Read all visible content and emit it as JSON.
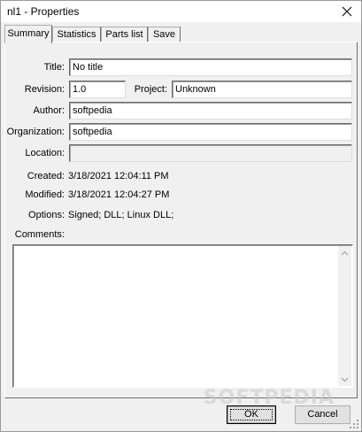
{
  "window": {
    "title": "nl1 - Properties"
  },
  "tabs": [
    {
      "label": "Summary",
      "active": true
    },
    {
      "label": "Statistics",
      "active": false
    },
    {
      "label": "Parts list",
      "active": false
    },
    {
      "label": "Save",
      "active": false
    }
  ],
  "form": {
    "title_label": "Title:",
    "title_value": "No title",
    "revision_label": "Revision:",
    "revision_value": "1.0",
    "project_label": "Project:",
    "project_value": "Unknown",
    "author_label": "Author:",
    "author_value": "softpedia",
    "organization_label": "Organization:",
    "organization_value": "softpedia",
    "location_label": "Location:",
    "location_value": "",
    "created_label": "Created:",
    "created_value": "3/18/2021 12:04:11 PM",
    "modified_label": "Modified:",
    "modified_value": "3/18/2021 12:04:27 PM",
    "options_label": "Options:",
    "options_value": "Signed; DLL; Linux DLL;",
    "comments_label": "Comments:",
    "comments_value": ""
  },
  "buttons": {
    "ok_label": "OK",
    "cancel_label": "Cancel"
  },
  "watermark": "SOFTPEDIA",
  "icons": {
    "close": "close-icon",
    "scroll_up": "arrow-up-icon",
    "scroll_down": "arrow-down-icon",
    "grip": "resize-grip-icon"
  }
}
